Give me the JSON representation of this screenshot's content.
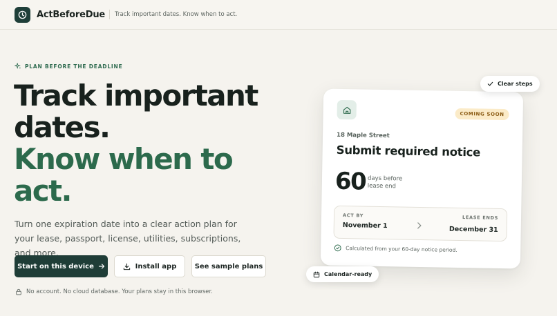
{
  "header": {
    "brand": "ActBeforeDue",
    "tagline": "Track important dates. Know when to act.",
    "logo_icon": "clock-icon"
  },
  "hero": {
    "eyebrow": "PLAN BEFORE THE DEADLINE",
    "headline_dark_1": "Track important",
    "headline_dark_2": "dates.",
    "headline_green_1": "Know when to",
    "headline_green_2": "act.",
    "description": "Turn one expiration date into a clear action plan for your lease, passport, license, utilities, subscriptions, and more.",
    "buttons": {
      "primary": "Start on this device",
      "install": "Install app",
      "sample": "See sample plans"
    },
    "privacy": "No account. No cloud database. Your plans stay in this browser."
  },
  "card": {
    "badge": "COMING SOON",
    "address": "18 Maple Street",
    "title": "Submit required notice",
    "number": "60",
    "number_caption_1": "days before",
    "number_caption_2": "lease end",
    "act_by_label": "ACT BY",
    "act_by_date": "November 1",
    "lease_ends_label": "LEASE ENDS",
    "lease_ends_date": "December 31",
    "calc_note": "Calculated from your 60-day notice period."
  },
  "chips": {
    "clear_steps": "Clear steps",
    "calendar_ready": "Calendar-ready"
  },
  "colors": {
    "brand_dark": "#1f3d37",
    "accent_green": "#2c6a4c",
    "badge_bg": "#fbebc8",
    "badge_text": "#8a5a12",
    "background": "#f5f3ee"
  }
}
